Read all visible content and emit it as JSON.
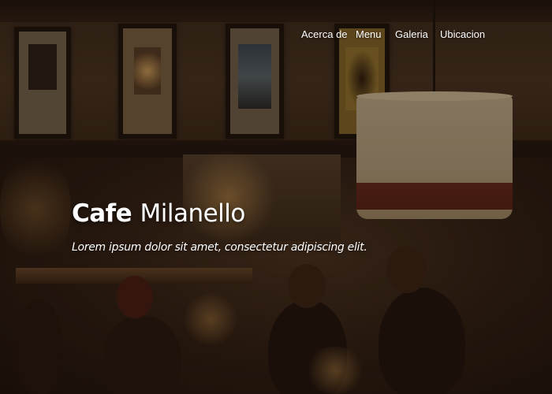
{
  "nav": {
    "items": [
      {
        "label": "Acerca de"
      },
      {
        "label": "Menu"
      },
      {
        "label": "Galeria"
      },
      {
        "label": "Ubicacion"
      }
    ]
  },
  "hero": {
    "title_bold": "Cafe",
    "title_light": "Milanello",
    "subtitle": "Lorem ipsum dolor sit amet, consectetur adipiscing elit."
  },
  "colors": {
    "text": "#ffffff",
    "overlay": "#2a1a10"
  }
}
